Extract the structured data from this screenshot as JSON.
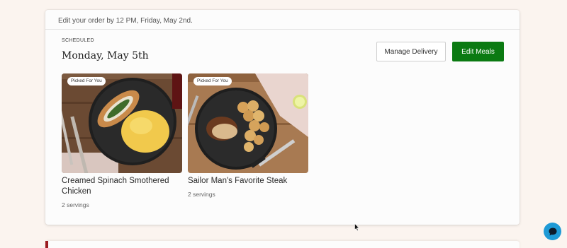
{
  "order": {
    "edit_notice": "Edit your order by 12 PM, Friday, May 2nd.",
    "status_label": "SCHEDULED",
    "delivery_date": "Monday, May 5th",
    "manage_label": "Manage Delivery",
    "edit_meals_label": "Edit Meals"
  },
  "meals": [
    {
      "badge": "Picked For You",
      "title": "Creamed Spinach Smothered Chicken",
      "servings": "2 servings"
    },
    {
      "badge": "Picked For You",
      "title": "Sailor Man's Favorite Steak",
      "servings": "2 servings"
    }
  ],
  "colors": {
    "accent_green": "#0b7a12",
    "page_bg": "#fbf4ef",
    "chat_blue": "#1e9ad6",
    "brand_red": "#9b1b1f"
  },
  "icons": {
    "chat": "chat-bubble-icon",
    "cursor": "mouse-cursor-icon"
  }
}
